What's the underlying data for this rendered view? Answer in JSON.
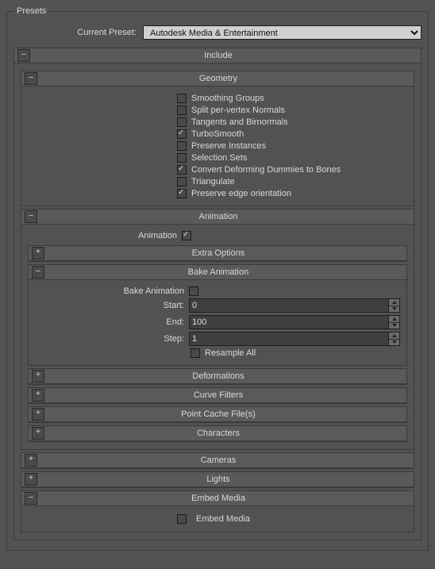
{
  "presets": {
    "legend": "Presets",
    "current_preset_label": "Current Preset:",
    "current_preset_value": "Autodesk Media & Entertainment"
  },
  "include": {
    "title": "Include",
    "geometry": {
      "title": "Geometry",
      "options": [
        {
          "label": "Smoothing Groups",
          "checked": false
        },
        {
          "label": "Split per-vertex Normals",
          "checked": false
        },
        {
          "label": "Tangents and Birnormals",
          "checked": false
        },
        {
          "label": "TurboSmooth",
          "checked": true
        },
        {
          "label": "Preserve Instances",
          "checked": false
        },
        {
          "label": "Selection Sets",
          "checked": false
        },
        {
          "label": "Convert Deforming Dummies to Bones",
          "checked": true
        },
        {
          "label": "Triangulate",
          "checked": false
        },
        {
          "label": "Preserve edge orientation",
          "checked": true
        }
      ]
    },
    "animation": {
      "title": "Animation",
      "enable_label": "Animation",
      "enable_checked": true,
      "extra_options": {
        "title": "Extra Options",
        "collapsed": true
      },
      "bake": {
        "title": "Bake Animation",
        "label": "Bake Animation",
        "checked": false,
        "start_label": "Start:",
        "start_value": "0",
        "end_label": "End:",
        "end_value": "100",
        "step_label": "Step:",
        "step_value": "1",
        "resample_label": "Resample All",
        "resample_checked": false
      },
      "deformations": {
        "title": "Deformations",
        "collapsed": true
      },
      "curve_filters": {
        "title": "Curve Filters",
        "collapsed": true
      },
      "point_cache": {
        "title": "Point Cache File(s)",
        "collapsed": true
      },
      "characters": {
        "title": "Characters",
        "collapsed": true
      }
    },
    "cameras": {
      "title": "Cameras",
      "collapsed": true
    },
    "lights": {
      "title": "Lights",
      "collapsed": true
    },
    "embed_media": {
      "title": "Embed Media",
      "option_label": "Embed Media",
      "option_checked": false
    }
  },
  "glyphs": {
    "minus": "–",
    "plus": "+"
  }
}
